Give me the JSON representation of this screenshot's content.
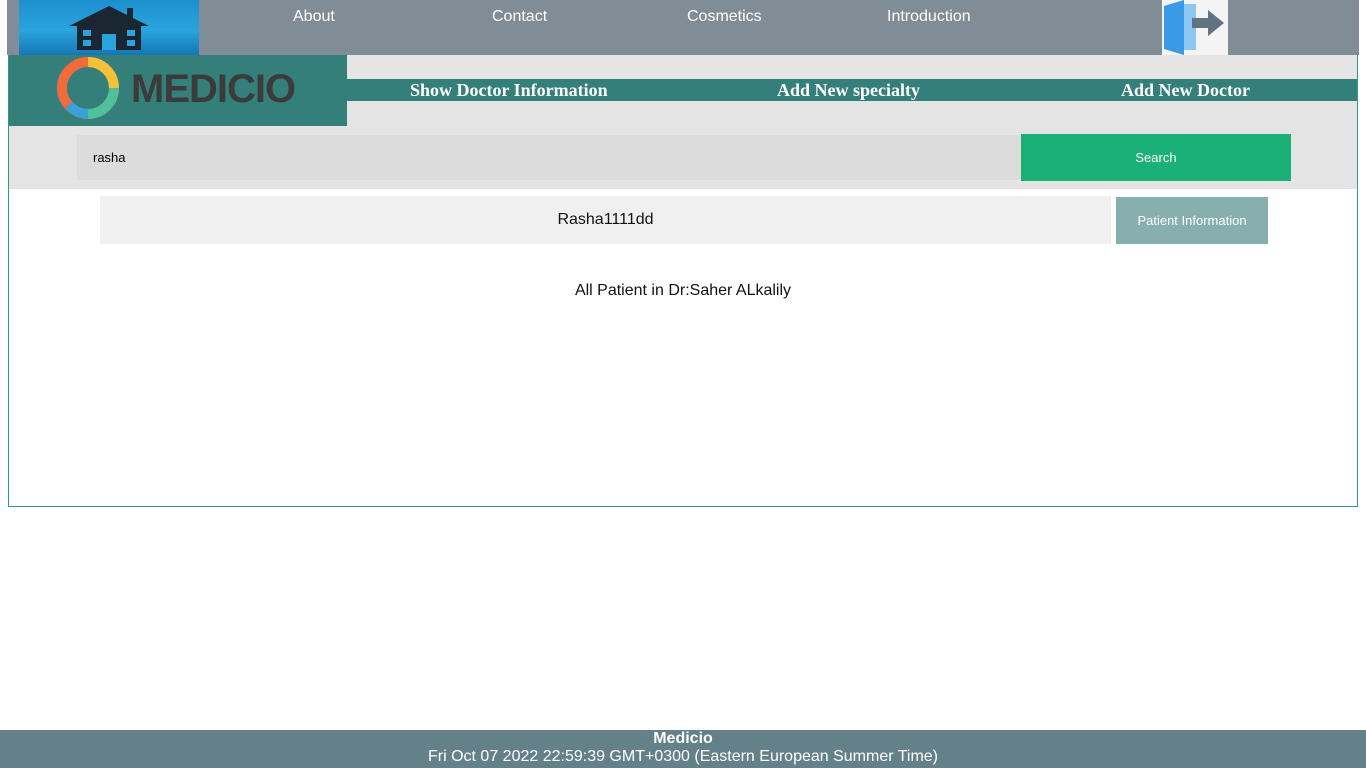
{
  "topnav": {
    "links": [
      "About",
      "Contact",
      "Cosmetics",
      "Introduction"
    ]
  },
  "brand": {
    "name": "MEDICIO"
  },
  "menu": [
    "Show Doctor Information",
    "Add New specialty",
    "Add New Doctor"
  ],
  "search": {
    "value": "rasha",
    "button_label": "Search"
  },
  "results": [
    {
      "name": "Rasha1111dd",
      "button_label": "Patient Information"
    }
  ],
  "all_patients_text": "All Patient in Dr:Saher ALkalily",
  "footer": {
    "title": "Medicio",
    "datetime": "Fri Oct 07 2022 22:59:39 GMT+0300 (Eastern European Summer Time)"
  },
  "colors": {
    "nav_bg": "#808c96",
    "teal": "#357f7a",
    "search_green": "#1ab077",
    "footer_bg": "#64818a"
  }
}
